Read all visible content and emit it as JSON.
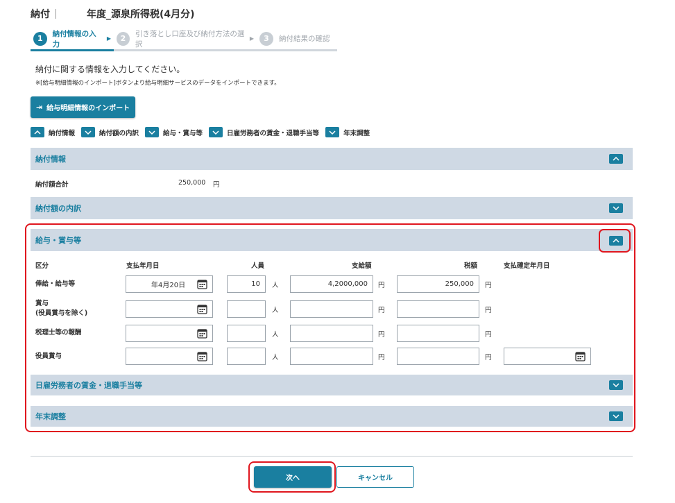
{
  "header": {
    "title_prefix": "納付",
    "title_suffix": "年度_源泉所得税(4月分)"
  },
  "steps": [
    {
      "num": "1",
      "label": "納付情報の入力"
    },
    {
      "num": "2",
      "label": "引き落とし口座及び納付方法の選択"
    },
    {
      "num": "3",
      "label": "納付結果の確認"
    }
  ],
  "intro": {
    "text": "納付に関する情報を入力してください。",
    "note": "※[給与明細情報のインポート]ボタンより給与明細サービスのデータをインポートできます。"
  },
  "import_button": {
    "label": "給与明細情報のインポート",
    "icon": "import-icon"
  },
  "anchors": [
    {
      "label": "納付情報",
      "icon": "chevron-up-icon"
    },
    {
      "label": "納付額の内訳",
      "icon": "chevron-down-icon"
    },
    {
      "label": "給与・賞与等",
      "icon": "chevron-down-icon"
    },
    {
      "label": "日雇労務者の賃金・退職手当等",
      "icon": "chevron-down-icon"
    },
    {
      "label": "年末調整",
      "icon": "chevron-down-icon"
    }
  ],
  "sections": {
    "payment_info": {
      "title": "納付情報",
      "state": "expanded"
    },
    "breakdown": {
      "title": "納付額の内訳",
      "state": "collapsed"
    },
    "salary": {
      "title": "給与・賞与等",
      "state": "expanded"
    },
    "day_labor": {
      "title": "日雇労務者の賃金・退職手当等",
      "state": "collapsed"
    },
    "year_end": {
      "title": "年末調整",
      "state": "collapsed"
    }
  },
  "total": {
    "label": "納付額合計",
    "value": "250,000",
    "unit": "円"
  },
  "table": {
    "headers": {
      "category": "区分",
      "pay_date": "支払年月日",
      "people": "人員",
      "amount": "支給額",
      "tax": "税額",
      "confirm_date": "支払確定年月日"
    },
    "units": {
      "people": "人",
      "yen": "円"
    },
    "rows": [
      {
        "label_line1": "俸給・給与等",
        "label_line2": "",
        "pay_date": "年4月20日",
        "people": "10",
        "amount": "4,2000,000",
        "tax": "250,000"
      },
      {
        "label_line1": "賞与",
        "label_line2": "(役員賞与を除く)",
        "pay_date": "",
        "people": "",
        "amount": "",
        "tax": ""
      },
      {
        "label_line1": "税理士等の報酬",
        "label_line2": "",
        "pay_date": "",
        "people": "",
        "amount": "",
        "tax": ""
      },
      {
        "label_line1": "役員賞与",
        "label_line2": "",
        "pay_date": "",
        "people": "",
        "amount": "",
        "tax": "",
        "confirm_date": ""
      }
    ]
  },
  "footer": {
    "next_label": "次へ",
    "cancel_label": "キャンセル"
  },
  "colors": {
    "accent": "#1a7fa0",
    "section_bg": "#cfd9e4",
    "highlight": "#e0161e"
  }
}
